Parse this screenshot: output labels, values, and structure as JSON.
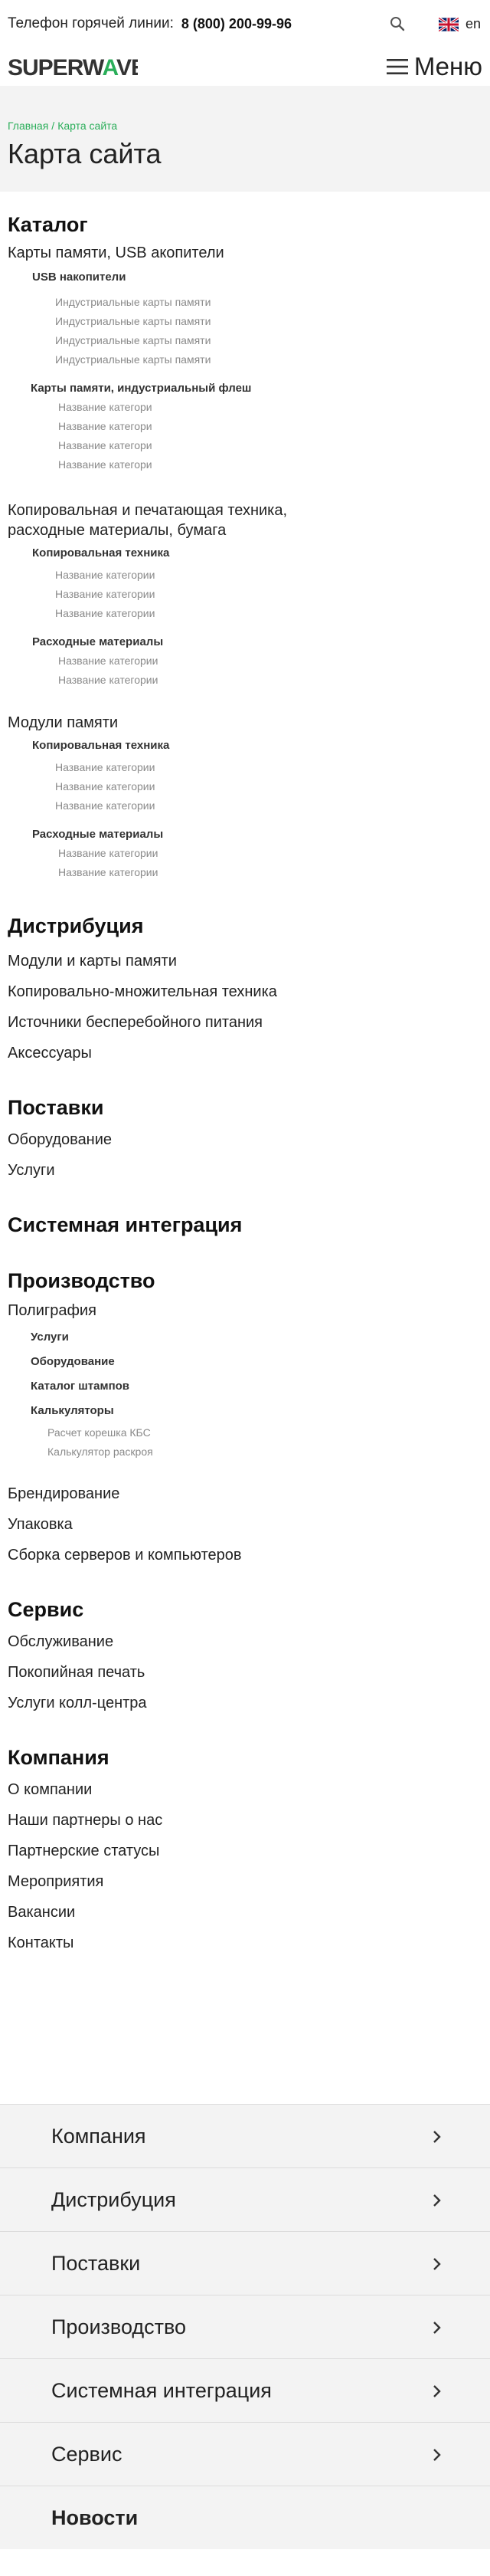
{
  "header": {
    "hotline_label": "Телефон горячей линии:",
    "hotline_phone": "8 (800) 200-99-96",
    "lang_label": "en",
    "logo_text_left": "SUPERW",
    "logo_text_v": "A",
    "logo_text_right": "VE",
    "menu_label": "Меню",
    "brand_green": "#2bae5a"
  },
  "breadcrumb": {
    "home": "Главная",
    "separator": "/",
    "current": "Карта сайта"
  },
  "page_title": "Карта сайта",
  "catalog": {
    "title": "Каталог",
    "memory": {
      "label": "Карты памяти, USB акопители",
      "groups": [
        {
          "label": "USB накопители",
          "items": [
            "Индустриальные карты памяти",
            "Индустриальные карты памяти",
            "Индустриальные карты памяти",
            "Индустриальные карты памяти"
          ]
        },
        {
          "label": "Карты памяти, индустриальный флеш",
          "items": [
            "Название категори",
            "Название категори",
            "Название категори",
            "Название категори"
          ]
        }
      ]
    },
    "copy": {
      "label_line1": "Копировальная и печатающая техника,",
      "label_line2": "расходные материалы, бумага",
      "groups": [
        {
          "label": "Копировальная техника",
          "items": [
            "Название категории",
            "Название категории",
            "Название категории"
          ]
        },
        {
          "label": "Расходные материалы",
          "items": [
            "Название категории",
            "Название категории"
          ]
        }
      ]
    },
    "modules": {
      "label": "Модули памяти",
      "groups": [
        {
          "label": "Копировальная техника",
          "items": [
            "Название категории",
            "Название категории",
            "Название категории"
          ]
        },
        {
          "label": "Расходные материалы",
          "items": [
            "Название категории",
            "Название категории"
          ]
        }
      ]
    }
  },
  "distribution": {
    "title": "Дистрибуция",
    "items": [
      "Модули и карты памяти",
      "Копировально-множительная техника",
      "Источники бесперебойного питания",
      "Аксессуары"
    ]
  },
  "supplies": {
    "title": "Поставки",
    "items": [
      "Оборудование",
      "Услуги"
    ]
  },
  "integration": {
    "title": "Системная интеграция"
  },
  "production": {
    "title": "Производство",
    "polygraphy": "Полиграфия",
    "sub": [
      "Услуги",
      "Оборудование",
      "Каталог штампов",
      "Калькуляторы"
    ],
    "calculators": [
      "Расчет корешка КБС",
      "Калькулятор раскроя"
    ],
    "items": [
      "Брендирование",
      "Упаковка",
      "Сборка серверов и компьютеров"
    ]
  },
  "service": {
    "title": "Сервис",
    "items": [
      "Обслуживание",
      "Покопийная печать",
      "Услуги колл-центра"
    ]
  },
  "company": {
    "title": "Компания",
    "items": [
      "О компании",
      "Наши партнеры о нас",
      "Партнерские статусы",
      "Мероприятия",
      "Вакансии",
      "Контакты"
    ]
  },
  "footer_menu": {
    "items": [
      "Компания",
      "Дистрибуция",
      "Поставки",
      "Производство",
      "Системная интеграция",
      "Сервис"
    ],
    "news": "Новости"
  }
}
